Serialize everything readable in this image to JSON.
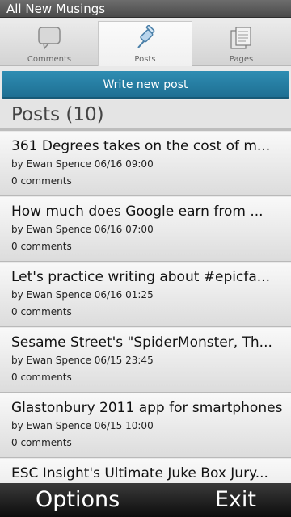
{
  "app": {
    "title": "All New Musings"
  },
  "tabs": [
    {
      "label": "Comments",
      "icon": "speech-bubble-icon"
    },
    {
      "label": "Posts",
      "icon": "pushpin-icon",
      "active": true
    },
    {
      "label": "Pages",
      "icon": "pages-icon"
    }
  ],
  "write_new_post_label": "Write new post",
  "posts_header": "Posts (10)",
  "posts": [
    {
      "title": "361 Degrees takes on the cost of m...",
      "meta": "by Ewan Spence 06/16 09:00",
      "comments": "0 comments"
    },
    {
      "title": "How much does Google earn from ...",
      "meta": "by Ewan Spence 06/16 07:00",
      "comments": "0 comments"
    },
    {
      "title": "Let's practice writing about #epicfa...",
      "meta": "by Ewan Spence 06/16 01:25",
      "comments": "0 comments"
    },
    {
      "title": "Sesame Street's \"SpiderMonster, Th...",
      "meta": "by Ewan Spence 06/15 23:45",
      "comments": "0 comments"
    },
    {
      "title": "Glastonbury 2011 app for smartphones",
      "meta": "by Ewan Spence 06/15 10:00",
      "comments": "0 comments"
    },
    {
      "title": "ESC Insight's Ultimate Juke Box Jury...",
      "meta": "",
      "comments": ""
    }
  ],
  "softkeys": {
    "left": "Options",
    "right": "Exit"
  },
  "colors": {
    "accent": "#2f8db3",
    "titlebar": "#5a5a5a",
    "softkeys": "#1a1a1a"
  }
}
